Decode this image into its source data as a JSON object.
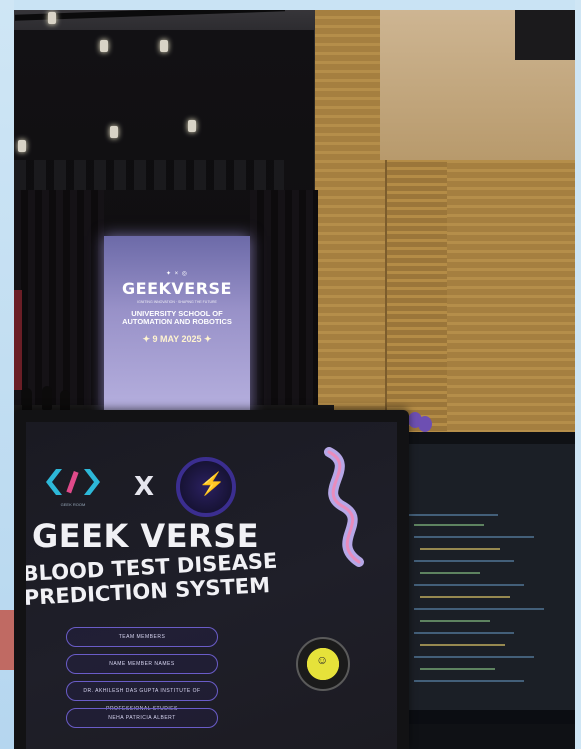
{
  "projection_screen": {
    "partners": "✦ × ◎",
    "title": "GEEKVERSE",
    "tagline": "IGNITING INNOVATION · SHAPING THE FUTURE",
    "school_line1": "UNIVERSITY SCHOOL OF",
    "school_line2": "AUTOMATION AND ROBOTICS",
    "date": "✦ 9 MAY 2025 ✦"
  },
  "laptop_slide": {
    "logo_caption": "GEEK ROOM",
    "cross": "X",
    "event_title": "GEEK VERSE",
    "project_line1": "BLOOD TEST DISEASE",
    "project_line2": "PREDICTION SYSTEM",
    "team_pills": [
      "TEAM MEMBERS",
      "NAME MEMBER NAMES",
      "DR. AKHILESH DAS GUPTA INSTITUTE OF PROFESSIONAL STUDIES",
      "NEHA PATRICIA ALBERT"
    ]
  },
  "colors": {
    "screen_glow": "#b8b2e0",
    "accent_purple": "#6a5cc8",
    "logo_cyan": "#2db8d8",
    "wall_wood": "#b58e4a"
  },
  "icons": [
    "geek-room-logo-icon",
    "bolt-logo-icon",
    "ribbon-graphic-icon",
    "badge-icon"
  ]
}
